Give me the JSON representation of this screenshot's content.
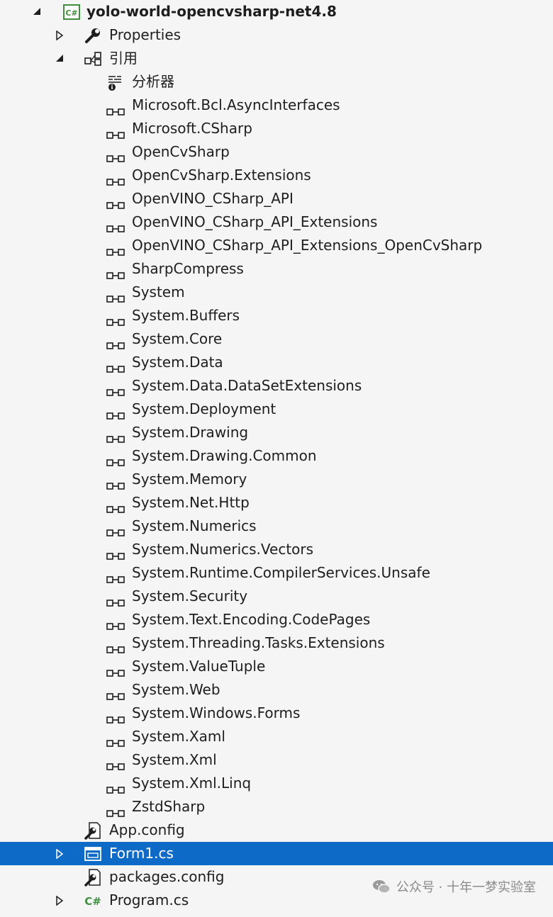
{
  "project": {
    "name": "yolo-world-opencvsharp-net4.8",
    "icon": "csharp-project-icon"
  },
  "properties": {
    "label": "Properties",
    "icon": "wrench-icon"
  },
  "references": {
    "label": "引用",
    "icon": "references-icon",
    "analyzer": {
      "label": "分析器",
      "icon": "analyzer-icon"
    },
    "items": [
      "Microsoft.Bcl.AsyncInterfaces",
      "Microsoft.CSharp",
      "OpenCvSharp",
      "OpenCvSharp.Extensions",
      "OpenVINO_CSharp_API",
      "OpenVINO_CSharp_API_Extensions",
      "OpenVINO_CSharp_API_Extensions_OpenCvSharp",
      "SharpCompress",
      "System",
      "System.Buffers",
      "System.Core",
      "System.Data",
      "System.Data.DataSetExtensions",
      "System.Deployment",
      "System.Drawing",
      "System.Drawing.Common",
      "System.Memory",
      "System.Net.Http",
      "System.Numerics",
      "System.Numerics.Vectors",
      "System.Runtime.CompilerServices.Unsafe",
      "System.Security",
      "System.Text.Encoding.CodePages",
      "System.Threading.Tasks.Extensions",
      "System.ValueTuple",
      "System.Web",
      "System.Windows.Forms",
      "System.Xaml",
      "System.Xml",
      "System.Xml.Linq",
      "ZstdSharp"
    ]
  },
  "files": [
    {
      "label": "App.config",
      "icon": "config-file-icon",
      "expandable": false,
      "selected": false
    },
    {
      "label": "Form1.cs",
      "icon": "form-icon",
      "expandable": true,
      "selected": true
    },
    {
      "label": "packages.config",
      "icon": "config-file-icon",
      "expandable": false,
      "selected": false
    },
    {
      "label": "Program.cs",
      "icon": "csharp-file-icon",
      "expandable": true,
      "selected": false
    }
  ],
  "watermark": {
    "text": "公众号 · 十年一梦实验室",
    "icon": "wechat-icon"
  },
  "colors": {
    "selection": "#0e6ac7",
    "background": "#f5f5f5",
    "csharp_green": "#3f8f3f"
  }
}
